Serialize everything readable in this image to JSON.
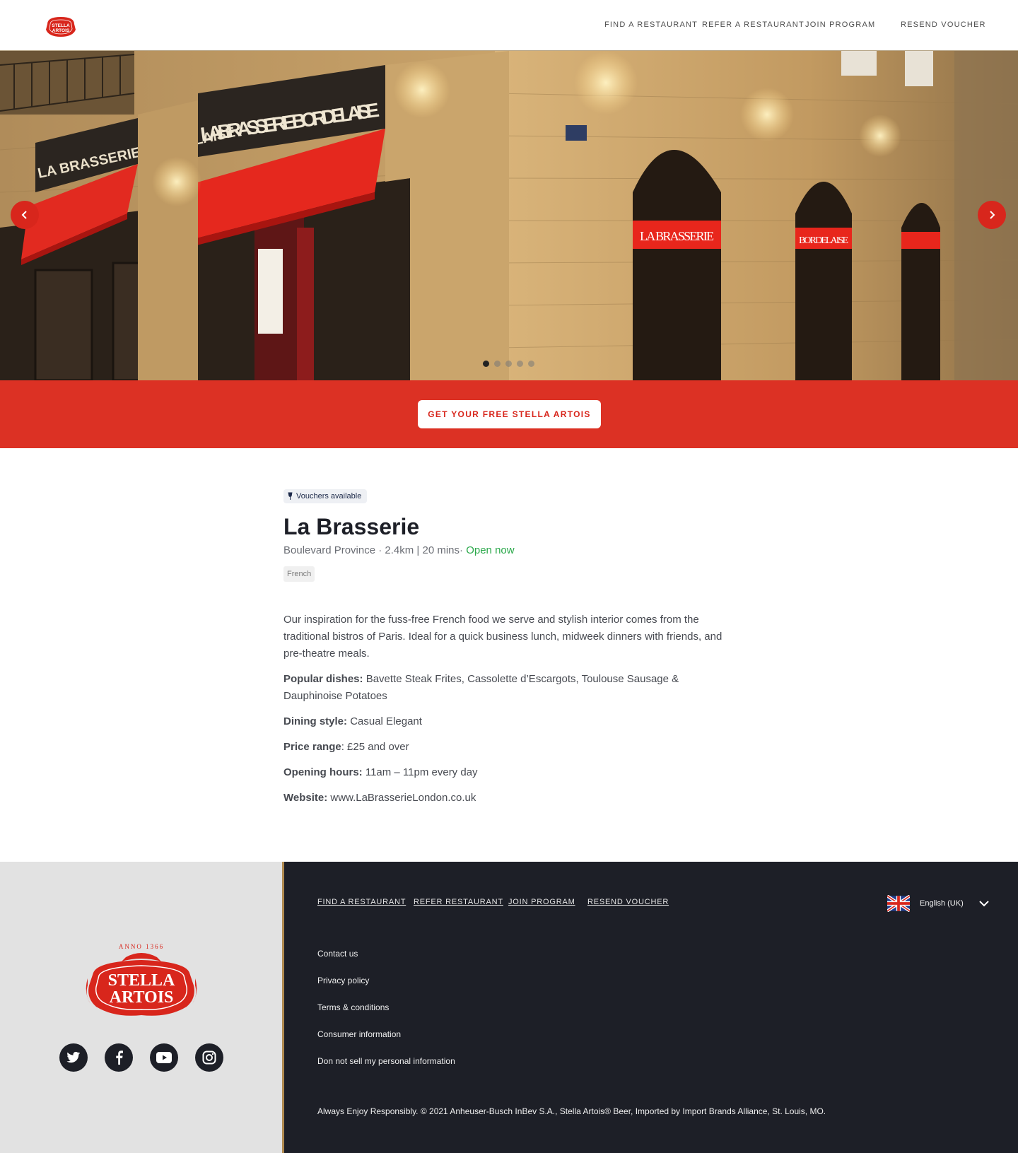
{
  "header": {
    "logo_text": "STELLA ARTOIS",
    "nav": [
      "FIND A RESTAURANT",
      "REFER A RESTAURANT",
      "JOIN PROGRAM",
      "RESEND VOUCHER"
    ]
  },
  "hero": {
    "signage": [
      "LA BRASSERIE BORDELAISE",
      "LA BRASSERIE BORDELAISE",
      "LA BRASSERIE",
      "BORDELAISE"
    ],
    "slide_count": 5,
    "active_slide": 1
  },
  "cta": {
    "label": "GET YOUR FREE STELLA ARTOIS"
  },
  "restaurant": {
    "badge": "Vouchers available",
    "name": "La Brasserie",
    "location": "Boulevard Province",
    "distance": "2.4km | 20 mins",
    "status": "Open now",
    "cuisine": "French",
    "description": "Our inspiration for the fuss-free French food we serve and stylish interior comes from the traditional bistros of Paris. Ideal for a quick business lunch, midweek dinners with friends, and pre-theatre meals.",
    "popular_label": "Popular dishes:",
    "popular_value": "Bavette Steak Frites, Cassolette d’Escargots, Toulouse Sausage & Dauphinoise Potatoes",
    "style_label": "Dining style:",
    "style_value": "Casual Elegant",
    "price_label": "Price range",
    "price_value": ": £25 and over",
    "hours_label": "Opening hours:",
    "hours_value": "11am – 11pm every day",
    "website_label": "Website:",
    "website_value": "www.LaBrasserieLondon.co.uk"
  },
  "footer": {
    "logo_top": "ANNO 1366",
    "logo_line1": "STELLA",
    "logo_line2": "ARTOIS",
    "nav": [
      "FIND A RESTAURANT",
      "REFER RESTAURANT",
      "JOIN PROGRAM",
      "RESEND VOUCHER"
    ],
    "links": [
      "Contact us",
      "Privacy policy",
      "Terms & conditions",
      "Consumer information",
      "Don not sell my personal information"
    ],
    "language": "English (UK)",
    "legal": "Always Enjoy Responsibly. © 2021 Anheuser-Busch InBev S.A., Stella Artois® Beer, Imported by Import Brands Alliance, St. Louis, MO.",
    "socials": [
      "twitter-icon",
      "facebook-icon",
      "youtube-icon",
      "instagram-icon"
    ]
  },
  "colors": {
    "brand_red": "#dc3124",
    "dark": "#1d1f27",
    "open_green": "#2aa84a"
  }
}
